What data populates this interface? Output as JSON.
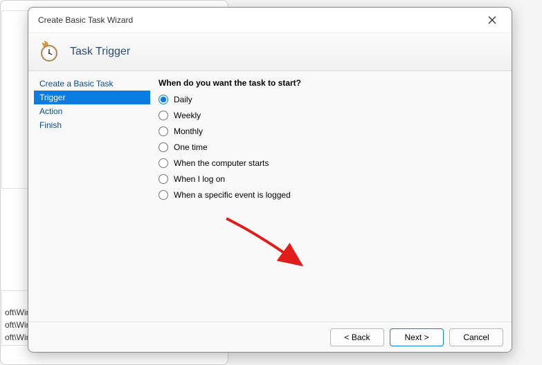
{
  "dialog": {
    "title": "Create Basic Task Wizard",
    "header": "Task Trigger"
  },
  "sidebar": {
    "items": [
      {
        "label": "Create a Basic Task",
        "selected": false
      },
      {
        "label": "Trigger",
        "selected": true
      },
      {
        "label": "Action",
        "selected": false
      },
      {
        "label": "Finish",
        "selected": false
      }
    ]
  },
  "content": {
    "question": "When do you want the task to start?",
    "options": [
      {
        "label": "Daily",
        "checked": true
      },
      {
        "label": "Weekly",
        "checked": false
      },
      {
        "label": "Monthly",
        "checked": false
      },
      {
        "label": "One time",
        "checked": false
      },
      {
        "label": "When the computer starts",
        "checked": false
      },
      {
        "label": "When I log on",
        "checked": false
      },
      {
        "label": "When a specific event is logged",
        "checked": false
      }
    ]
  },
  "footer": {
    "back": "< Back",
    "next": "Next >",
    "cancel": "Cancel"
  },
  "bg": {
    "line1": "oft\\Wind...",
    "line2": "oft\\Windows\\U...",
    "line3": "oft\\Windows\\Fli..."
  }
}
